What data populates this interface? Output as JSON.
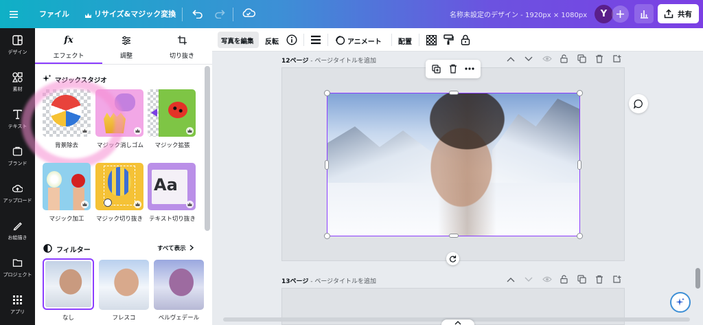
{
  "topbar": {
    "file_label": "ファイル",
    "resize_label": "リサイズ&マジック変換",
    "doc_title": "名称未設定のデザイン - 1920px × 1080px",
    "avatar_letter": "Y",
    "share_label": "共有"
  },
  "rail": {
    "items": [
      {
        "label": "デザイン",
        "icon": "layout-icon"
      },
      {
        "label": "素材",
        "icon": "elements-icon"
      },
      {
        "label": "テキスト",
        "icon": "text-icon"
      },
      {
        "label": "ブランド",
        "icon": "brand-icon"
      },
      {
        "label": "アップロード",
        "icon": "upload-icon"
      },
      {
        "label": "お絵描き",
        "icon": "draw-icon"
      },
      {
        "label": "プロジェクト",
        "icon": "folder-icon"
      },
      {
        "label": "アプリ",
        "icon": "apps-icon"
      }
    ]
  },
  "panel": {
    "tabs": [
      {
        "label": "エフェクト",
        "icon": "fx-icon"
      },
      {
        "label": "調整",
        "icon": "sliders-icon"
      },
      {
        "label": "切り抜き",
        "icon": "crop-icon"
      }
    ],
    "magic_studio_title": "マジックスタジオ",
    "magic_items": [
      {
        "label": "背景除去"
      },
      {
        "label": "マジック消しゴム"
      },
      {
        "label": "マジック拡張"
      },
      {
        "label": "マジック加工"
      },
      {
        "label": "マジック切り抜き"
      },
      {
        "label": "テキスト切り抜き"
      }
    ],
    "tile_text_sample": "Aa",
    "filters_title": "フィルター",
    "show_all": "すべて表示",
    "filters": [
      {
        "label": "なし"
      },
      {
        "label": "フレスコ"
      },
      {
        "label": "ベルヴェデール"
      }
    ]
  },
  "context_toolbar": {
    "edit_photo": "写真を編集",
    "flip": "反転",
    "animate": "アニメート",
    "position": "配置"
  },
  "canvas": {
    "page12_number": "12ページ",
    "page12_title": "ページタイトルを追加",
    "page13_number": "13ページ",
    "page13_title": "ページタイトルを追加",
    "separator": " - "
  },
  "colors": {
    "accent": "#8b3dff",
    "rail_bg": "#18191b",
    "canvas_bg": "#e8ebef"
  }
}
